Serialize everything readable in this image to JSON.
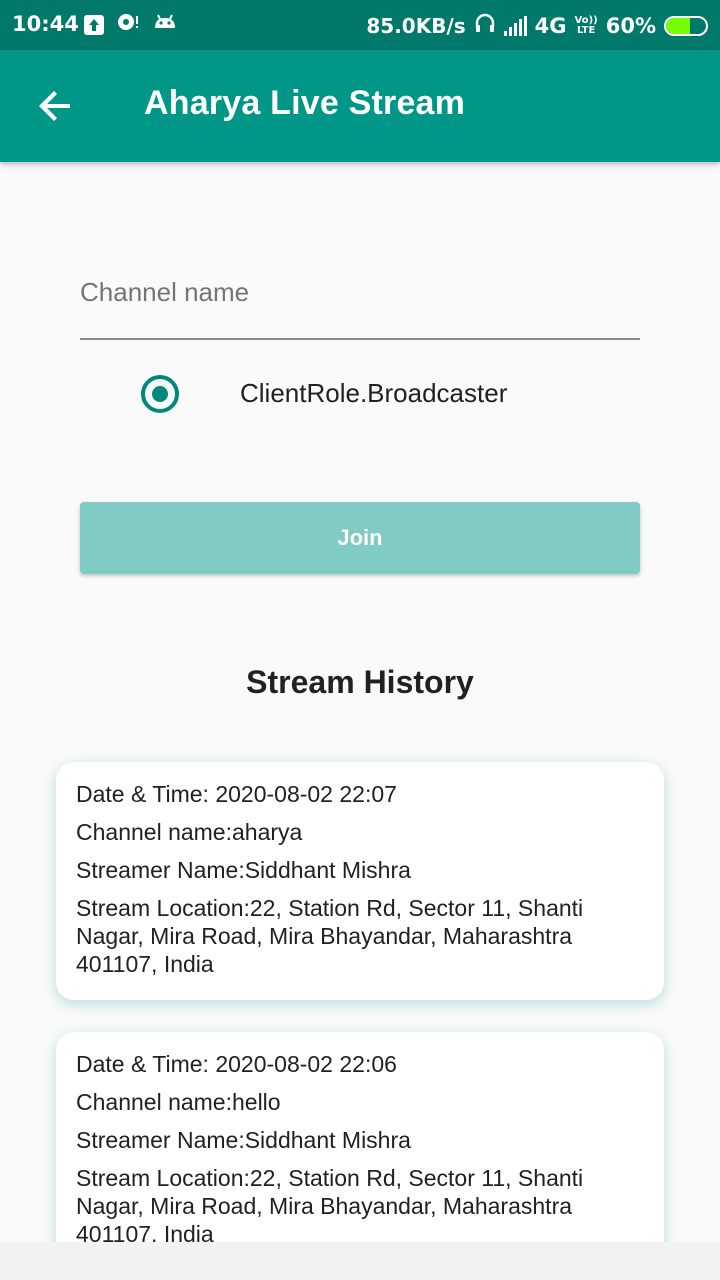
{
  "status_bar": {
    "time": "10:44",
    "network_speed": "85.0KB/s",
    "network_type": "4G",
    "volte_line1": "Vo))",
    "volte_line2": "LTE",
    "battery_percent": "60%",
    "battery_level": 0.6,
    "icons": [
      "upload-icon",
      "notification-icon",
      "android-icon",
      "headphones-icon",
      "signal-icon",
      "battery-charging-icon"
    ]
  },
  "app_bar": {
    "title": "Aharya Live Stream",
    "back_icon": "arrow-back-icon",
    "color": "#009688"
  },
  "form": {
    "channel_placeholder": "Channel name",
    "channel_value": "",
    "role_label": "ClientRole.Broadcaster",
    "role_selected": true,
    "join_label": "Join",
    "join_color": "#80cbc4"
  },
  "history": {
    "title": "Stream History",
    "items": [
      {
        "datetime": "Date & Time: 2020-08-02 22:07",
        "channel": "Channel name:aharya",
        "streamer": "Streamer Name:Siddhant Mishra",
        "location": "Stream Location:22, Station Rd, Sector 11, Shanti Nagar, Mira Road, Mira Bhayandar, Maharashtra 401107, India"
      },
      {
        "datetime": "Date & Time: 2020-08-02 22:06",
        "channel": "Channel name:hello",
        "streamer": "Streamer Name:Siddhant Mishra",
        "location": "Stream Location:22, Station Rd, Sector 11, Shanti Nagar, Mira Road, Mira Bhayandar, Maharashtra 401107, India"
      }
    ]
  }
}
